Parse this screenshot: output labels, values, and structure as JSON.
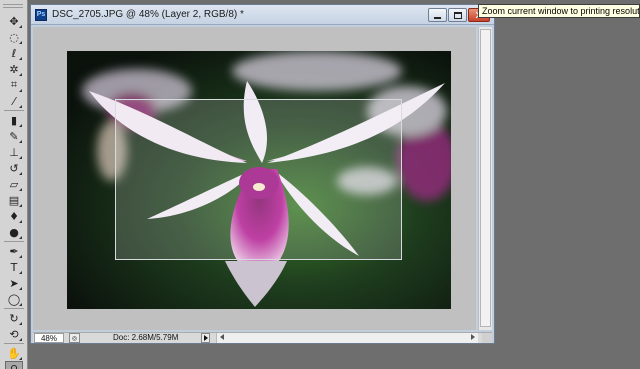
{
  "document": {
    "badge": "Ps",
    "title": "DSC_2705.JPG @ 48% (Layer 2, RGB/8) *",
    "buttons": {
      "minimize": "minimize",
      "maximize": "maximize",
      "close": "close"
    }
  },
  "status_bar": {
    "zoom": "48%",
    "doc_info": "Doc: 2.68M/5.79M"
  },
  "tooltip": {
    "text": "Zoom current window to printing resolution"
  },
  "tools": [
    {
      "name": "move-tool",
      "icon": "move-icon",
      "glyph": "✥"
    },
    {
      "name": "marquee-tool",
      "icon": "marquee-icon",
      "glyph": "◌"
    },
    {
      "name": "lasso-tool",
      "icon": "lasso-icon",
      "glyph": "ℓ"
    },
    {
      "name": "quick-selection-tool",
      "icon": "magic-wand-icon",
      "glyph": "✲"
    },
    {
      "name": "crop-tool",
      "icon": "crop-icon",
      "glyph": "⌗"
    },
    {
      "name": "eyedropper-tool",
      "icon": "eyedropper-icon",
      "glyph": "⁄"
    },
    {
      "name": "healing-brush-tool",
      "icon": "bandage-icon",
      "glyph": "▮"
    },
    {
      "name": "brush-tool",
      "icon": "brush-icon",
      "glyph": "✎"
    },
    {
      "name": "clone-stamp-tool",
      "icon": "stamp-icon",
      "glyph": "⊥"
    },
    {
      "name": "history-brush-tool",
      "icon": "history-brush-icon",
      "glyph": "↺"
    },
    {
      "name": "eraser-tool",
      "icon": "eraser-icon",
      "glyph": "▱"
    },
    {
      "name": "gradient-tool",
      "icon": "gradient-icon",
      "glyph": "▤"
    },
    {
      "name": "blur-tool",
      "icon": "droplet-icon",
      "glyph": "♦"
    },
    {
      "name": "dodge-tool",
      "icon": "dodge-icon",
      "glyph": "●"
    },
    {
      "name": "pen-tool",
      "icon": "pen-icon",
      "glyph": "✒"
    },
    {
      "name": "type-tool",
      "icon": "type-icon",
      "glyph": "T"
    },
    {
      "name": "path-selection-tool",
      "icon": "arrow-icon",
      "glyph": "➤"
    },
    {
      "name": "shape-tool",
      "icon": "ellipse-icon",
      "glyph": "◯"
    },
    {
      "name": "3d-rotate-tool",
      "icon": "3d-rotate-icon",
      "glyph": "↻"
    },
    {
      "name": "3d-orbit-tool",
      "icon": "3d-orbit-icon",
      "glyph": "⟲"
    },
    {
      "name": "hand-tool",
      "icon": "hand-icon",
      "glyph": "✋"
    },
    {
      "name": "zoom-tool",
      "icon": "zoom-icon",
      "glyph": "⚲"
    }
  ],
  "active_tool": "zoom-tool",
  "colors": {
    "workspace": "#6e6e6e",
    "canvas_bg": "#c0c0c0",
    "orchid_magenta": "#b0168f",
    "tooltip_bg": "#ffffe1"
  }
}
